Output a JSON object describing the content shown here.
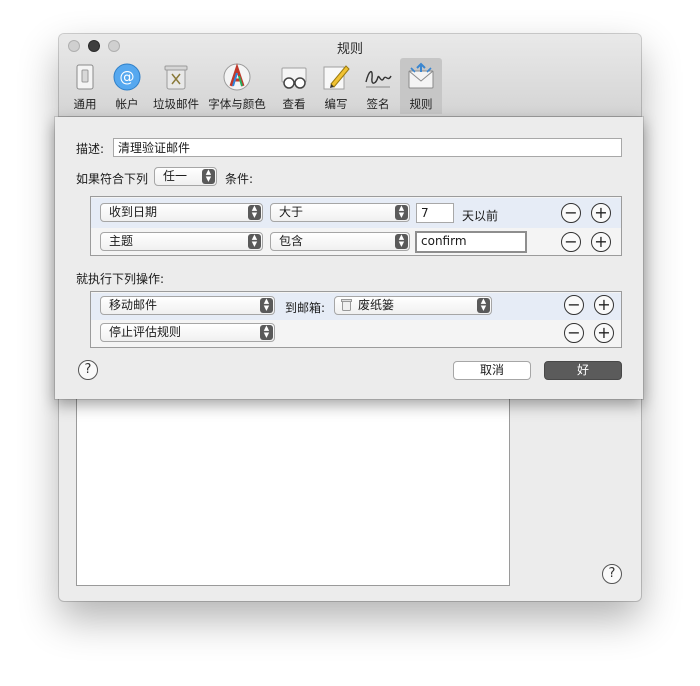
{
  "window": {
    "title": "规则"
  },
  "toolbar": {
    "items": [
      {
        "label": "通用",
        "icon": "switch-icon"
      },
      {
        "label": "帐户",
        "icon": "at-sign-icon"
      },
      {
        "label": "垃圾邮件",
        "icon": "trash-icon"
      },
      {
        "label": "字体与颜色",
        "icon": "font-icon"
      },
      {
        "label": "查看",
        "icon": "glasses-icon"
      },
      {
        "label": "编写",
        "icon": "pencil-icon"
      },
      {
        "label": "签名",
        "icon": "signature-icon"
      },
      {
        "label": "规则",
        "icon": "rules-envelope-icon",
        "selected": true
      }
    ]
  },
  "sheet": {
    "description_label": "描述:",
    "description_value": "清理验证邮件",
    "if_label": "如果符合下列",
    "match_mode": "任一",
    "conditions_suffix": "条件:",
    "conditions": [
      {
        "field": "收到日期",
        "operator": "大于",
        "value": "7",
        "unit": "天以前"
      },
      {
        "field": "主题",
        "operator": "包含",
        "value": "confirm"
      }
    ],
    "actions_label": "就执行下列操作:",
    "actions": [
      {
        "action": "移动邮件",
        "target_label": "到邮箱:",
        "mailbox": "废纸篓"
      },
      {
        "action": "停止评估规则"
      }
    ],
    "help": "?",
    "cancel_label": "取消",
    "ok_label": "好"
  },
  "window_help": "?",
  "colors": {
    "ok_button": "#5b5b5b",
    "selected_row": "#e6ecf6"
  }
}
